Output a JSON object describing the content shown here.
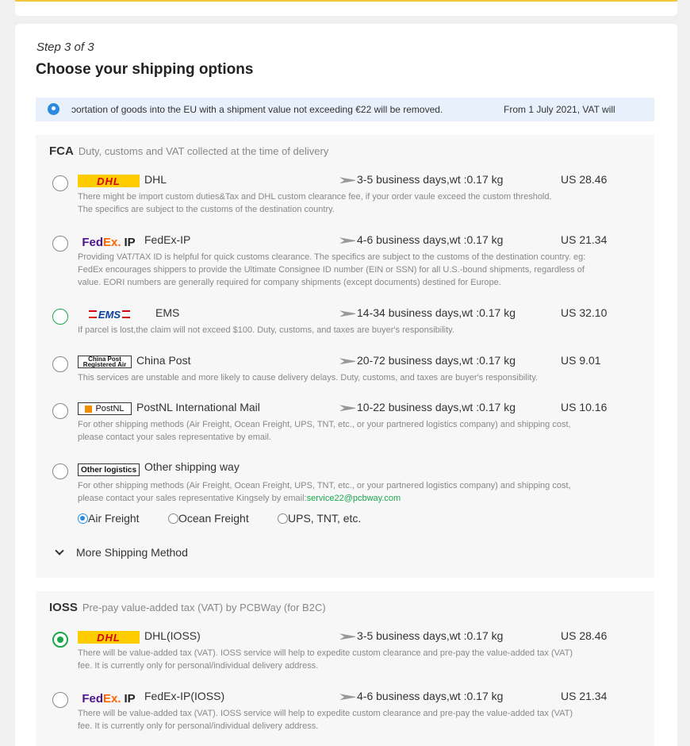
{
  "step": "Step 3 of 3",
  "title": "Choose your shipping options",
  "notice": {
    "text1": "ɔortation of goods into the EU with a shipment value not exceeding €22 will be removed.",
    "text2": "From 1 July 2021, VAT will"
  },
  "fca": {
    "code": "FCA",
    "desc": "Duty, customs and VAT collected at the time of delivery",
    "options": [
      {
        "logo": "DHL",
        "carrier": "DHL",
        "days": "3-5 business days,wt :0.17 kg",
        "price": "US 28.46",
        "note1": "There might be import custom duties&Tax and DHL custom clearance fee, if your order vaule exceed the custom threshold.",
        "note2": "The specifics are subject to the customs of the destination country."
      },
      {
        "logo_a": "Fed",
        "logo_b": "Ex.",
        "logo_c": "IP",
        "carrier": "FedEx-IP",
        "days": "4-6 business days,wt :0.17 kg",
        "price": "US 21.34",
        "note1": "Providing VAT/TAX ID is helpful for quick customs clearance. The specifics are subject to the customs of the destination country. eg:",
        "note2": "FedEx encourages shippers to provide the Ultimate Consignee ID number (EIN or SSN) for all U.S.-bound shipments, regardless of",
        "note3": "value. EORI numbers are generally required for company shipments (except documents) destined for Europe."
      },
      {
        "logo": "EMS",
        "carrier": "EMS",
        "days": "14-34 business days,wt :0.17 kg",
        "price": "US 32.10",
        "note1": "If parcel is lost,the claim will not exceed $100. Duty, customs, and taxes are buyer's responsibility."
      },
      {
        "logo_a": "China Post",
        "logo_b": "Registered Air",
        "carrier": "China Post",
        "days": "20-72 business days,wt :0.17 kg",
        "price": "US 9.01",
        "note1": "This services are unstable and more likely to cause delivery delays. Duty, customs, and taxes are buyer's responsibility."
      },
      {
        "logo": "PostNL",
        "carrier": "PostNL International Mail",
        "days": "10-22 business days,wt :0.17 kg",
        "price": "US 10.16",
        "note1": "For other shipping methods (Air Freight, Ocean Freight, UPS, TNT, etc., or your partnered logistics company) and shipping cost,",
        "note2": "please contact your sales representative by email."
      },
      {
        "logo": "Other logistics",
        "carrier": "Other shipping way",
        "note1": "For other shipping methods (Air Freight, Ocean Freight, UPS, TNT, etc., or your partnered logistics company) and shipping cost,",
        "note2": "please contact your sales representative Kingsely by email:",
        "email": "service22@pcbway.com"
      }
    ],
    "freight": [
      "Air Freight",
      "Ocean Freight",
      "UPS, TNT, etc."
    ],
    "more": "More Shipping Method"
  },
  "ioss": {
    "code": "IOSS",
    "desc": "Pre-pay value-added tax (VAT) by PCBWay (for B2C)",
    "options": [
      {
        "logo": "DHL",
        "carrier": "DHL(IOSS)",
        "days": "3-5 business days,wt :0.17 kg",
        "price": "US 28.46",
        "note1": "There will be value-added tax (VAT). IOSS service will help to expedite custom clearance and pre-pay the value-added tax (VAT)",
        "note2": "fee. It is currently only for personal/individual delivery address."
      },
      {
        "logo_a": "Fed",
        "logo_b": "Ex.",
        "logo_c": "IP",
        "carrier": "FedEx-IP(IOSS)",
        "days": "4-6 business days,wt :0.17 kg",
        "price": "US 21.34",
        "note1": "There will be value-added tax (VAT). IOSS service will help to expedite custom clearance and pre-pay the value-added tax (VAT)",
        "note2": "fee. It is currently only for personal/individual delivery address."
      }
    ]
  },
  "colors": {
    "accent_green": "#1aa84b",
    "info_blue": "#2a8be0",
    "dhl_yellow": "#ffcc00",
    "dhl_red": "#d40511"
  }
}
